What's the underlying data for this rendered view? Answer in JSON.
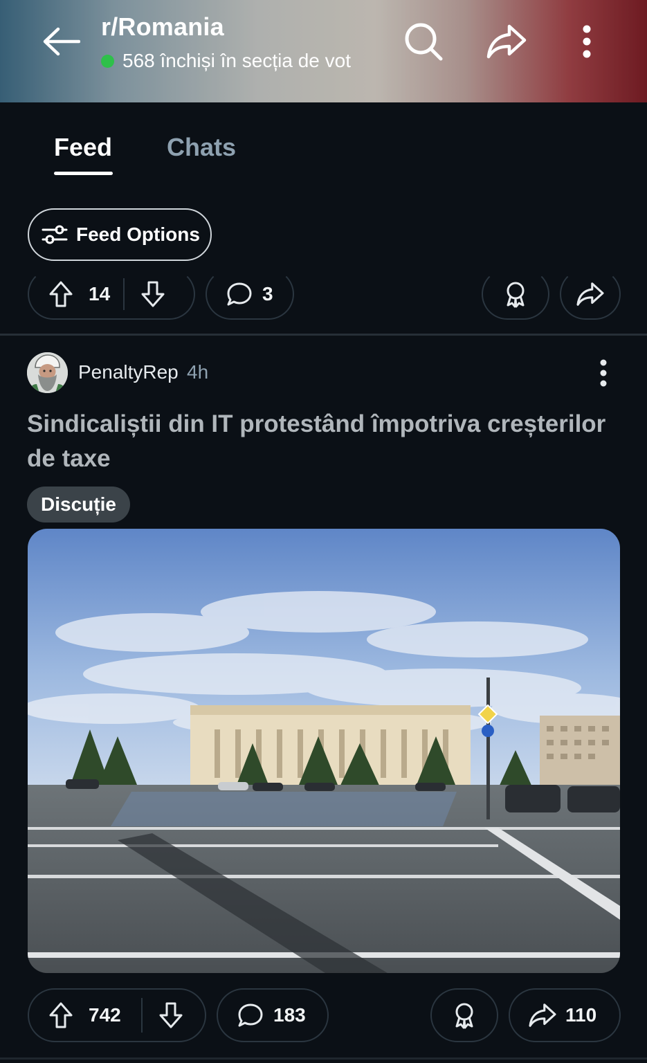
{
  "header": {
    "subreddit": "r/Romania",
    "online_text": "568 închiși în secția de vot",
    "online_dot_color": "#2ec04a",
    "icons": [
      "back-arrow-icon",
      "search-icon",
      "share-icon",
      "more-vertical-icon"
    ]
  },
  "tabs": [
    {
      "label": "Feed",
      "active": true
    },
    {
      "label": "Chats",
      "active": false
    }
  ],
  "feed_options": {
    "label": "Feed Options",
    "icon": "sliders-icon"
  },
  "prev_post_actions": {
    "upvotes": "14",
    "comments": "3"
  },
  "post": {
    "author": "PenaltyRep",
    "time": "4h",
    "title": "Sindicaliștii din IT protestând împotriva creșterilor de taxe",
    "flair": "Discuție",
    "upvotes": "742",
    "comments": "183",
    "shares": "110"
  },
  "colors": {
    "background": "#0b1016",
    "title_text": "#b0b6bb",
    "inactive_tab": "#8ea1b0"
  }
}
